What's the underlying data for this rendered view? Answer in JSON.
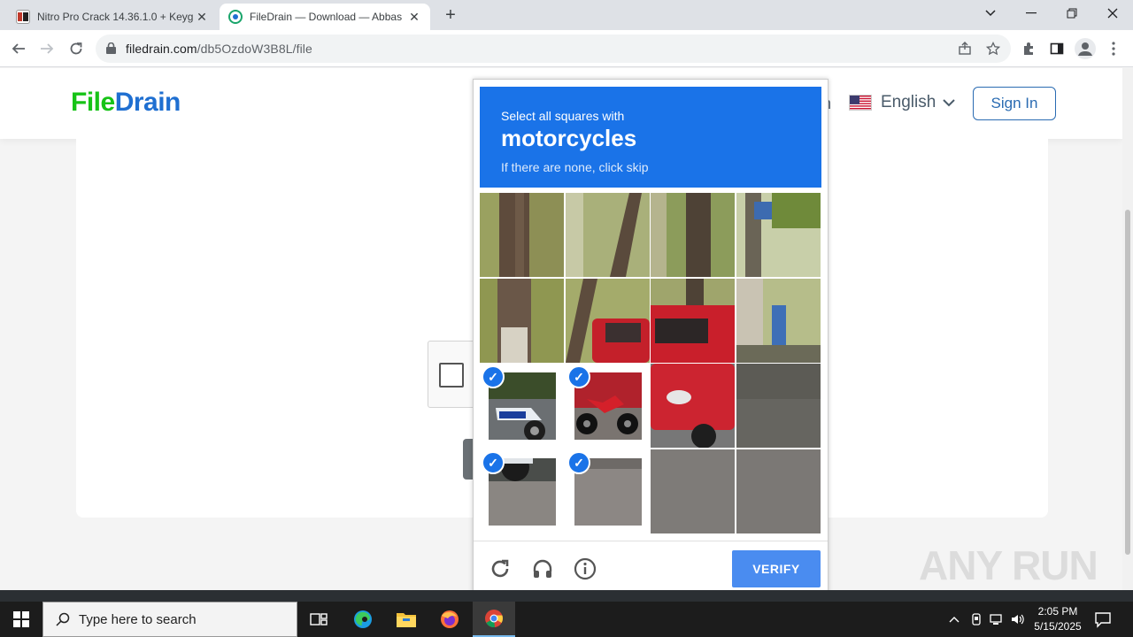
{
  "browser": {
    "tabs": [
      {
        "title": "Nitro Pro Crack 14.36.1.0 + Keyg",
        "active": false
      },
      {
        "title": "FileDrain — Download — Abbas",
        "active": true
      }
    ],
    "new_tab_label": "+",
    "url_host": "filedrain.com",
    "url_path": "/db5OzdoW3B8L/file"
  },
  "site": {
    "logo_part1": "File",
    "logo_part2": "Drain",
    "header_partial": "n",
    "language": "English",
    "signin_label": "Sign In"
  },
  "captcha": {
    "instruction_line1": "Select all squares with",
    "target_object": "motorcycles",
    "instruction_line3": "If there are none, click skip",
    "verify_label": "VERIFY",
    "selected_tiles": [
      8,
      9,
      12,
      13
    ],
    "accent_color": "#1a73e8"
  },
  "watermark": "ANY RUN",
  "taskbar": {
    "search_placeholder": "Type here to search",
    "time": "2:05 PM",
    "date": "5/15/2025"
  }
}
